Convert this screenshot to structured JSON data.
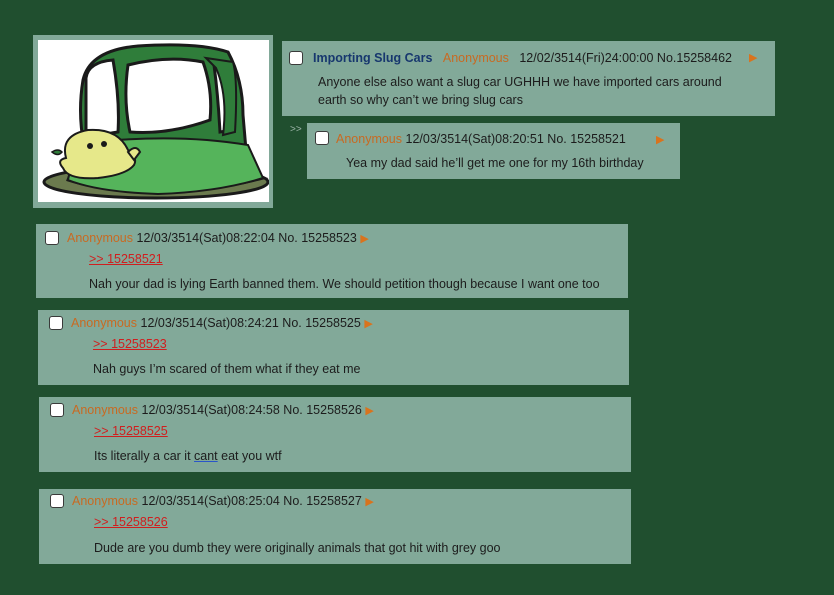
{
  "op": {
    "image_alt": "slug car drawing",
    "subject": "Importing Slug Cars",
    "name": "Anonymous",
    "date": "12/02/3514(Fri)24:00:00",
    "number": "No.15258462",
    "body": "Anyone else also want a slug car UGHHH we have imported cars around earth so why can’t we bring slug cars"
  },
  "reply_marker": ">>",
  "arrow": "▶",
  "replies": [
    {
      "name": "Anonymous",
      "date": "12/03/3514(Sat)08:20:51",
      "number": "No. 15258521",
      "quote": "",
      "body": "Yea my dad said he’ll get me one for my 16th birthday"
    },
    {
      "name": "Anonymous",
      "date": "12/03/3514(Sat)08:22:04",
      "number": "No. 15258523",
      "quote": ">> 15258521",
      "body": "Nah your dad is lying Earth banned them. We should petition though because I want one too"
    },
    {
      "name": "Anonymous",
      "date": "12/03/3514(Sat)08:24:21",
      "number": "No. 15258525",
      "quote": ">> 15258523",
      "body": "Nah guys I’m scared of them what if they eat me"
    },
    {
      "name": "Anonymous",
      "date": "12/03/3514(Sat)08:24:58",
      "number": "No. 15258526",
      "quote": ">> 15258525",
      "body_pre": "Its literally a car it ",
      "body_mid": "cant",
      "body_post": " eat you wtf"
    },
    {
      "name": "Anonymous",
      "date": "12/03/3514(Sat)08:25:04",
      "number": "No. 15258527",
      "quote": ">> 15258526",
      "body": "Dude are you dumb they were originally animals that got hit with grey goo"
    }
  ]
}
